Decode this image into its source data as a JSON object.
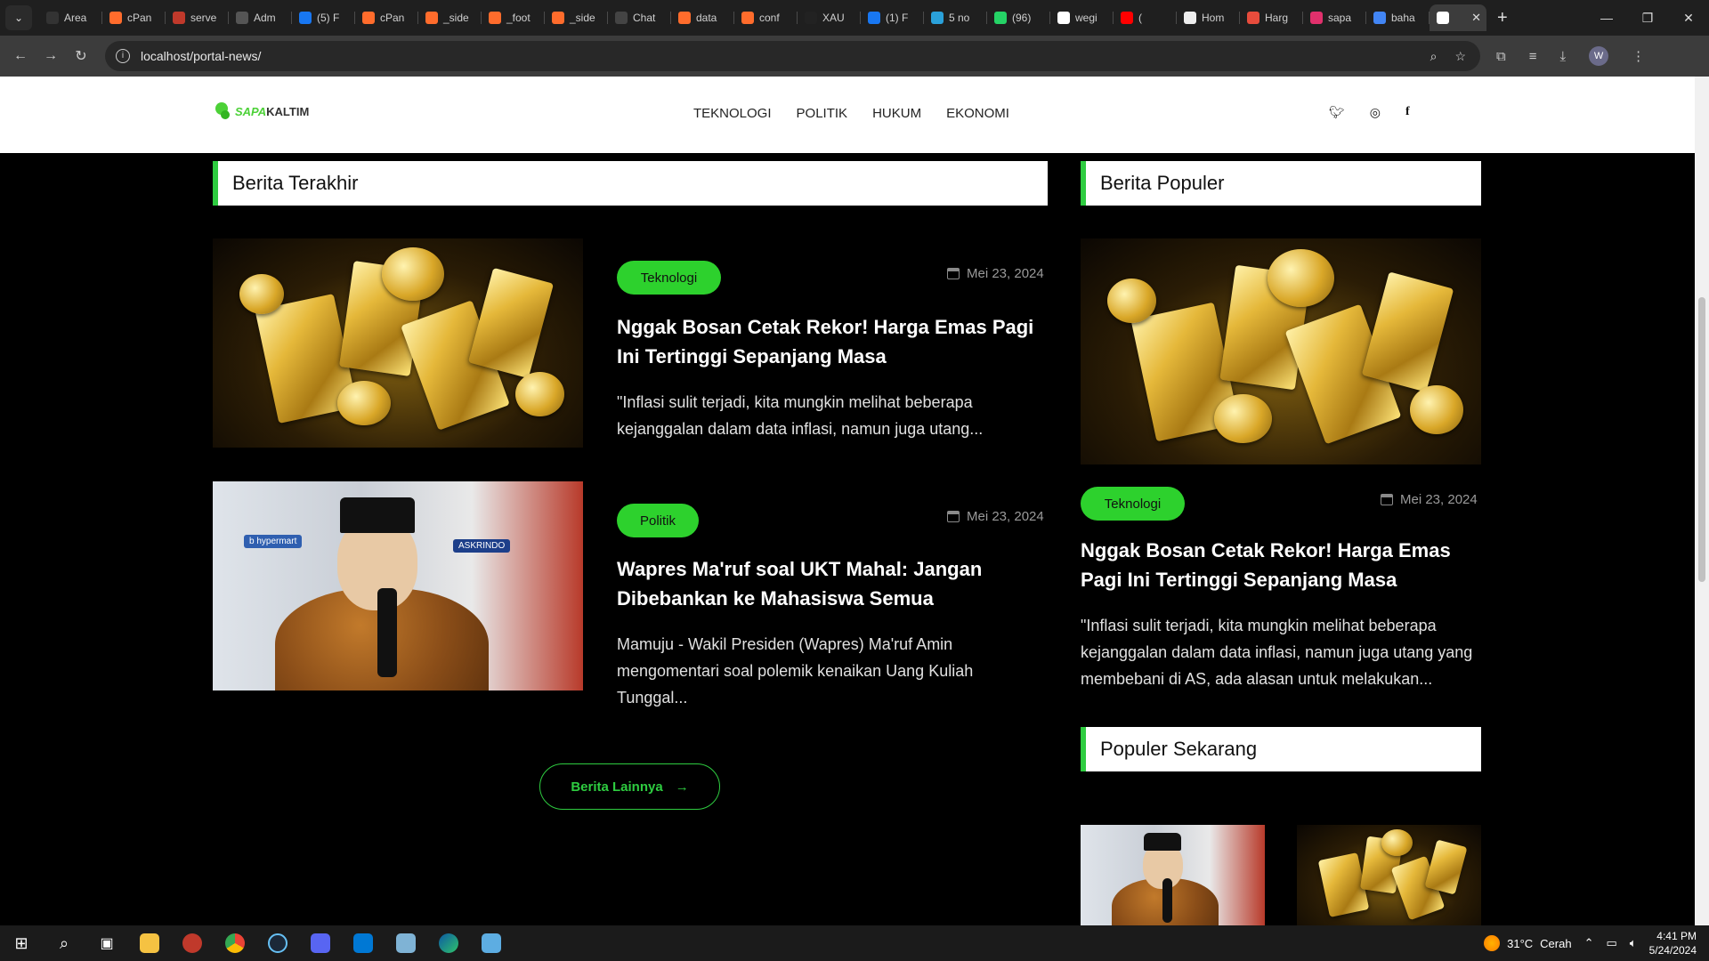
{
  "browser": {
    "tabs": [
      {
        "label": "Area",
        "color": "#333333"
      },
      {
        "label": "cPan",
        "color": "#ff6c2c"
      },
      {
        "label": "serve",
        "color": "#c0392b"
      },
      {
        "label": "Adm",
        "color": "#555555"
      },
      {
        "label": "(5) F",
        "color": "#1877f2"
      },
      {
        "label": "cPan",
        "color": "#ff6c2c"
      },
      {
        "label": "_side",
        "color": "#ff6c2c"
      },
      {
        "label": "_foot",
        "color": "#ff6c2c"
      },
      {
        "label": "_side",
        "color": "#ff6c2c"
      },
      {
        "label": "Chat",
        "color": "#444444"
      },
      {
        "label": "data",
        "color": "#ff6c2c"
      },
      {
        "label": "conf",
        "color": "#ff6c2c"
      },
      {
        "label": "XAU",
        "color": "#222222"
      },
      {
        "label": "(1) F",
        "color": "#1877f2"
      },
      {
        "label": "5 no",
        "color": "#2aa1da"
      },
      {
        "label": "(96)",
        "color": "#25d366"
      },
      {
        "label": "wegi",
        "color": "#ffffff"
      },
      {
        "label": "(",
        "color": "#ff0000"
      },
      {
        "label": "Hom",
        "color": "#eeeeee"
      },
      {
        "label": "Harg",
        "color": "#e74c3c"
      },
      {
        "label": "sapa",
        "color": "#e1306c"
      },
      {
        "label": "baha",
        "color": "#4285f4"
      }
    ],
    "url": "localhost/portal-news/",
    "profile_initial": "W"
  },
  "site": {
    "logo_sapa": "SAPA",
    "logo_kaltim": "KALTIM",
    "nav": [
      "TEKNOLOGI",
      "POLITIK",
      "HUKUM",
      "EKONOMI"
    ]
  },
  "latest": {
    "heading": "Berita Terakhir",
    "posts": [
      {
        "category": "Teknologi",
        "date": "Mei 23, 2024",
        "title": "Nggak Bosan Cetak Rekor! Harga Emas Pagi Ini Tertinggi Sepanjang Masa",
        "excerpt": "\"Inflasi sulit terjadi, kita mungkin melihat beberapa kejanggalan dalam data inflasi, namun juga utang..."
      },
      {
        "category": "Politik",
        "date": "Mei 23, 2024",
        "title": "Wapres Ma'ruf soal UKT Mahal: Jangan Dibebankan ke Mahasiswa Semua",
        "excerpt": "Mamuju - Wakil Presiden (Wapres) Ma'ruf Amin mengomentari soal polemik kenaikan Uang Kuliah Tunggal..."
      }
    ],
    "more_label": "Berita Lainnya"
  },
  "popular": {
    "heading": "Berita Populer",
    "post": {
      "category": "Teknologi",
      "date": "Mei 23, 2024",
      "title": "Nggak Bosan Cetak Rekor! Harga Emas Pagi Ini Tertinggi Sepanjang Masa",
      "excerpt": "\"Inflasi sulit terjadi, kita mungkin melihat beberapa kejanggalan dalam data inflasi, namun juga utang yang membebani di AS, ada alasan untuk melakukan..."
    },
    "now_heading": "Populer Sekarang"
  },
  "taskbar": {
    "weather_temp": "31°C",
    "weather_desc": "Cerah",
    "time": "4:41 PM",
    "date": "5/24/2024"
  }
}
